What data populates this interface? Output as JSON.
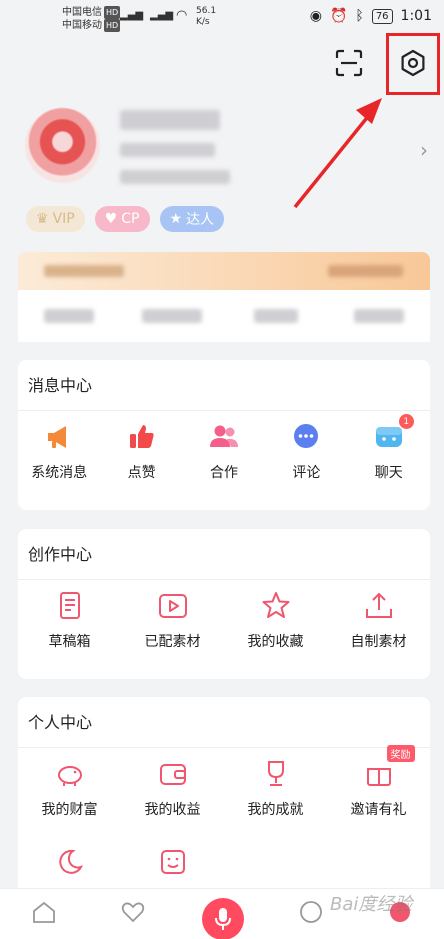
{
  "status_bar": {
    "carrier1": "中国电信",
    "carrier2": "中国移动",
    "hd": "HD",
    "net1": "4G",
    "net2": "4G",
    "speed_value": "56.1",
    "speed_unit": "K/s",
    "battery": "76",
    "time": "1:01"
  },
  "profile": {
    "badges": [
      {
        "label": "VIP",
        "icon": "crown-icon"
      },
      {
        "label": "CP",
        "icon": "heart-icon"
      },
      {
        "label": "达人",
        "icon": "star-icon"
      }
    ]
  },
  "message_center": {
    "title": "消息中心",
    "items": [
      {
        "label": "系统消息",
        "icon": "megaphone-icon",
        "color": "#f5893a"
      },
      {
        "label": "点赞",
        "icon": "thumbs-up-icon",
        "color": "#f24a4a"
      },
      {
        "label": "合作",
        "icon": "people-icon",
        "color": "#f55e8a"
      },
      {
        "label": "评论",
        "icon": "chat-bubble-icon",
        "color": "#5b7ef0"
      },
      {
        "label": "聊天",
        "icon": "chat-icon",
        "color": "#4fb6f0",
        "badge": "1"
      }
    ]
  },
  "creation_center": {
    "title": "创作中心",
    "items": [
      {
        "label": "草稿箱",
        "icon": "document-icon"
      },
      {
        "label": "已配素材",
        "icon": "play-icon"
      },
      {
        "label": "我的收藏",
        "icon": "star-outline-icon"
      },
      {
        "label": "自制素材",
        "icon": "upload-icon"
      }
    ]
  },
  "personal_center": {
    "title": "个人中心",
    "items": [
      {
        "label": "我的财富",
        "icon": "piggy-bank-icon"
      },
      {
        "label": "我的收益",
        "icon": "wallet-icon"
      },
      {
        "label": "我的成就",
        "icon": "trophy-icon"
      },
      {
        "label": "邀请有礼",
        "icon": "gift-icon",
        "tag": "奖励"
      }
    ]
  },
  "watermark": "Bai度经验",
  "colors": {
    "accent": "#f0566e",
    "highlight_box": "#e8262a"
  }
}
